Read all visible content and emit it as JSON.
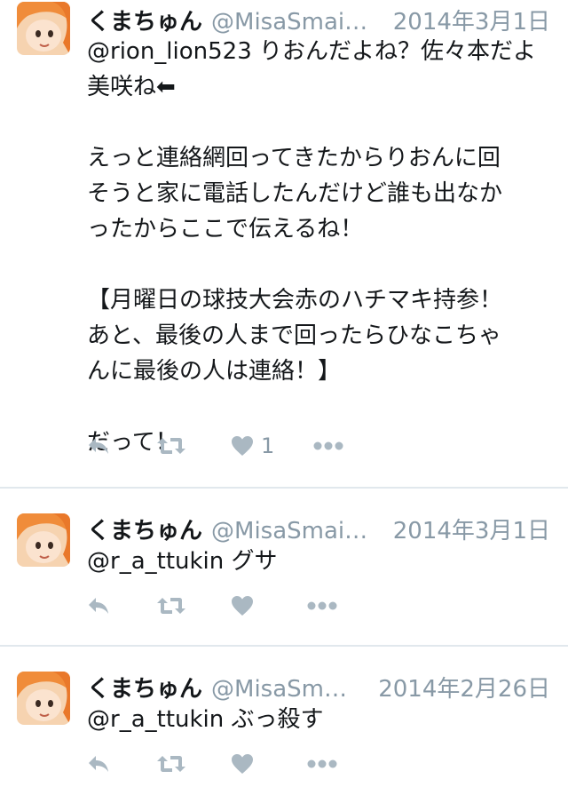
{
  "tweets": [
    {
      "name": "くまちゅん",
      "handle": "@MisaSmai…",
      "date": "2014年3月1日",
      "text": "@rion_lion523 りおんだよね？佐々本だよ\n美咲ね⬅\n\nえっと連絡網回ってきたからりおんに回\nそうと家に電話したんだけど誰も出なか\nったからここで伝えるね！\n\n【月曜日の球技大会赤のハチマキ持参！\nあと、最後の人まで回ったらひなこちゃ\nんに最後の人は連絡！】\n\nだって！",
      "likes": "1"
    },
    {
      "name": "くまちゅん",
      "handle": "@MisaSmai…",
      "date": "2014年3月1日",
      "text": "@r_a_ttukin グサ",
      "likes": ""
    },
    {
      "name": "くまちゅん",
      "handle": "@MisaSm…",
      "date": "2014年2月26日",
      "text": "@r_a_ttukin ぶっ殺す",
      "likes": ""
    }
  ],
  "icons": {
    "reply": "reply-icon",
    "retweet": "retweet-icon",
    "like": "heart-icon",
    "more": "more-icon"
  },
  "colors": {
    "name": "#14171a",
    "meta": "#8899a6",
    "action_icon": "#aab8c2",
    "divider": "#e1e8ed"
  }
}
